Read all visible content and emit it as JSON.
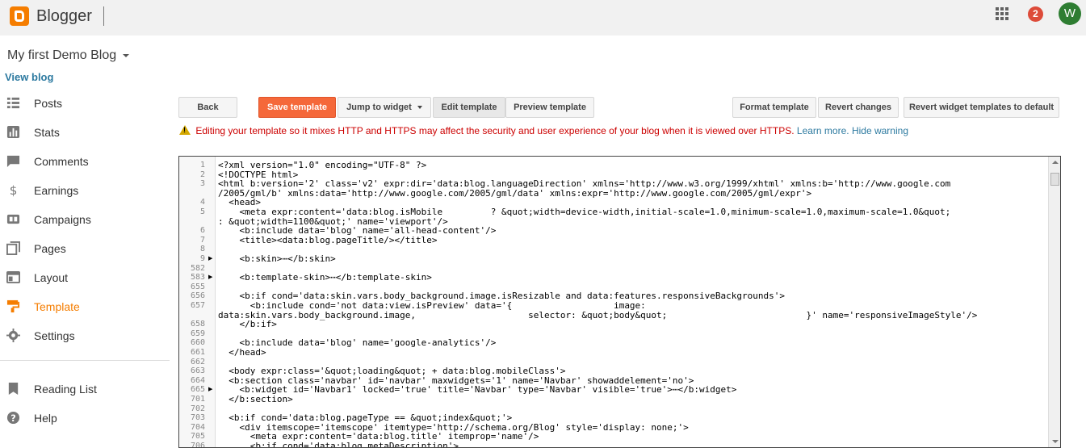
{
  "app": {
    "name": "Blogger",
    "notifications": "2",
    "avatar_letter": "W"
  },
  "blog": {
    "title": "My first Demo Blog",
    "view_blog": "View blog"
  },
  "sidebar": {
    "items": [
      {
        "label": "Posts",
        "icon": "posts-icon"
      },
      {
        "label": "Stats",
        "icon": "stats-icon"
      },
      {
        "label": "Comments",
        "icon": "comments-icon"
      },
      {
        "label": "Earnings",
        "icon": "dollar-icon"
      },
      {
        "label": "Campaigns",
        "icon": "campaigns-icon"
      },
      {
        "label": "Pages",
        "icon": "pages-icon"
      },
      {
        "label": "Layout",
        "icon": "layout-icon"
      },
      {
        "label": "Template",
        "icon": "template-icon",
        "active": true
      },
      {
        "label": "Settings",
        "icon": "gear-icon"
      }
    ],
    "secondary": [
      {
        "label": "Reading List",
        "icon": "bookmark-icon"
      },
      {
        "label": "Help",
        "icon": "help-icon"
      }
    ]
  },
  "toolbar": {
    "back": "Back",
    "save_template": "Save template",
    "jump_to_widget": "Jump to widget",
    "edit_template": "Edit template",
    "preview_template": "Preview template",
    "format_template": "Format template",
    "revert_changes": "Revert changes",
    "revert_widgets": "Revert widget templates to default"
  },
  "warning": {
    "text": "Editing your template so it mixes HTTP and HTTPS may affect the security and user experience of your blog when it is viewed over HTTPS.",
    "learn_more": "Learn more.",
    "hide": "Hide warning"
  },
  "editor": {
    "lines": [
      {
        "num": "1",
        "fold": false,
        "text": "<?xml version=\"1.0\" encoding=\"UTF-8\" ?>"
      },
      {
        "num": "2",
        "fold": false,
        "text": "<!DOCTYPE html>"
      },
      {
        "num": "3",
        "fold": false,
        "text": "<html b:version='2' class='v2' expr:dir='data:blog.languageDirection' xmlns='http://www.w3.org/1999/xhtml' xmlns:b='http://www.google.com"
      },
      {
        "num": "",
        "fold": false,
        "text": "/2005/gml/b' xmlns:data='http://www.google.com/2005/gml/data' xmlns:expr='http://www.google.com/2005/gml/expr'>"
      },
      {
        "num": "4",
        "fold": false,
        "text": "  <head>"
      },
      {
        "num": "5",
        "fold": false,
        "text": "    <meta expr:content='data:blog.isMobile         ? &quot;width=device-width,initial-scale=1.0,minimum-scale=1.0,maximum-scale=1.0&quot;"
      },
      {
        "num": "",
        "fold": false,
        "text": ": &quot;width=1100&quot;' name='viewport'/>"
      },
      {
        "num": "6",
        "fold": false,
        "text": "    <b:include data='blog' name='all-head-content'/>"
      },
      {
        "num": "7",
        "fold": false,
        "text": "    <title><data:blog.pageTitle/></title>"
      },
      {
        "num": "8",
        "fold": false,
        "text": ""
      },
      {
        "num": "9",
        "fold": true,
        "text": "    <b:skin>⋯</b:skin>"
      },
      {
        "num": "582",
        "fold": false,
        "text": ""
      },
      {
        "num": "583",
        "fold": true,
        "text": "    <b:template-skin>⋯</b:template-skin>"
      },
      {
        "num": "655",
        "fold": false,
        "text": ""
      },
      {
        "num": "656",
        "fold": false,
        "text": "    <b:if cond='data:skin.vars.body_background.image.isResizable and data:features.responsiveBackgrounds'>"
      },
      {
        "num": "657",
        "fold": false,
        "text": "      <b:include cond='not data:view.isPreview' data='{                   image:"
      },
      {
        "num": "",
        "fold": false,
        "text": "data:skin.vars.body_background.image,                     selector: &quot;body&quot;                          }' name='responsiveImageStyle'/>"
      },
      {
        "num": "658",
        "fold": false,
        "text": "    </b:if>"
      },
      {
        "num": "659",
        "fold": false,
        "text": ""
      },
      {
        "num": "660",
        "fold": false,
        "text": "    <b:include data='blog' name='google-analytics'/>"
      },
      {
        "num": "661",
        "fold": false,
        "text": "  </head>"
      },
      {
        "num": "662",
        "fold": false,
        "text": ""
      },
      {
        "num": "663",
        "fold": false,
        "text": "  <body expr:class='&quot;loading&quot; + data:blog.mobileClass'>"
      },
      {
        "num": "664",
        "fold": false,
        "text": "  <b:section class='navbar' id='navbar' maxwidgets='1' name='Navbar' showaddelement='no'>"
      },
      {
        "num": "665",
        "fold": true,
        "text": "    <b:widget id='Navbar1' locked='true' title='Navbar' type='Navbar' visible='true'>⋯</b:widget>"
      },
      {
        "num": "701",
        "fold": false,
        "text": "  </b:section>"
      },
      {
        "num": "702",
        "fold": false,
        "text": ""
      },
      {
        "num": "703",
        "fold": false,
        "text": "  <b:if cond='data:blog.pageType == &quot;index&quot;'>"
      },
      {
        "num": "704",
        "fold": false,
        "text": "    <div itemscope='itemscope' itemtype='http://schema.org/Blog' style='display: none;'>"
      },
      {
        "num": "705",
        "fold": false,
        "text": "      <meta expr:content='data:blog.title' itemprop='name'/>"
      },
      {
        "num": "706",
        "fold": false,
        "text": "      <b:if cond='data:blog.metaDescription'>"
      }
    ]
  }
}
